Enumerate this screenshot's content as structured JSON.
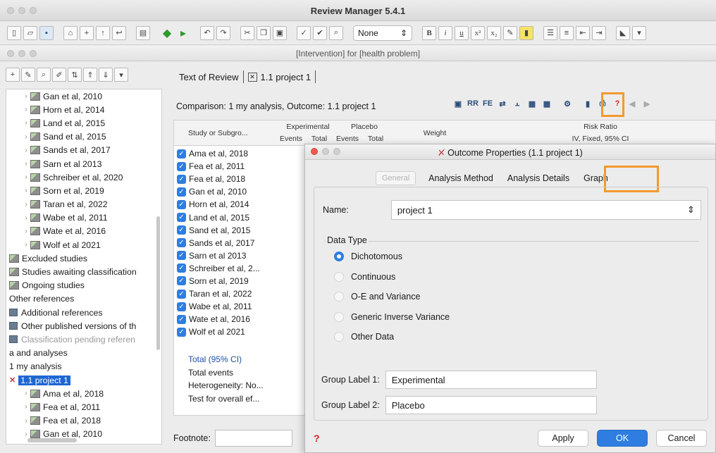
{
  "app": {
    "title": "Review Manager 5.4.1"
  },
  "toolbar": {
    "style_select": "None"
  },
  "document": {
    "title": "[Intervention] for [health problem]"
  },
  "tabs": [
    {
      "label": "Text of Review"
    },
    {
      "label": "1.1 project 1"
    }
  ],
  "comparison": {
    "label": "Comparison: 1 my analysis, Outcome: 1.1 project 1"
  },
  "right_toolbar": {
    "rr": "RR",
    "fe": "FE"
  },
  "grid": {
    "study_header": "Study or Subgro...",
    "experimental": "Experimental",
    "placebo": "Placebo",
    "events": "Events",
    "total": "Total",
    "weight": "Weight",
    "risk_ratio": "Risk Ratio",
    "rr_method": "IV, Fixed, 95% CI",
    "studies": [
      "Ama et al, 2018",
      "Fea et al, 2011",
      "Fea et al, 2018",
      "Gan et al, 2010",
      "Horn et al, 2014",
      "Land et al, 2015",
      "Sand et al, 2015",
      "Sands et al, 2017",
      "Sarn et al 2013",
      "Schreiber et al, 2...",
      "Sorn et al, 2019",
      "Taran et al, 2022",
      "Wabe et al, 2011",
      "Wate et al, 2016",
      "Wolf et al 2021"
    ],
    "totals": {
      "total": "Total (95% CI)",
      "events": "Total events",
      "heterogeneity": "Heterogeneity: No...",
      "overall": "Test for overall ef..."
    }
  },
  "footnote": {
    "label": "Footnote:"
  },
  "tree": {
    "items": [
      {
        "label": "Gan et al, 2010",
        "type": "study",
        "indent": 1
      },
      {
        "label": "Horn et al, 2014",
        "type": "study",
        "indent": 1
      },
      {
        "label": "Land et al, 2015",
        "type": "study",
        "indent": 1
      },
      {
        "label": "Sand et al, 2015",
        "type": "study",
        "indent": 1
      },
      {
        "label": "Sands et al, 2017",
        "type": "study",
        "indent": 1
      },
      {
        "label": "Sarn et al 2013",
        "type": "study",
        "indent": 1
      },
      {
        "label": "Schreiber et al, 2020",
        "type": "study",
        "indent": 1
      },
      {
        "label": "Sorn et al, 2019",
        "type": "study",
        "indent": 1
      },
      {
        "label": "Taran et al, 2022",
        "type": "study",
        "indent": 1
      },
      {
        "label": "Wabe et al, 2011",
        "type": "study",
        "indent": 1
      },
      {
        "label": "Wate et al, 2016",
        "type": "study",
        "indent": 1
      },
      {
        "label": "Wolf et al 2021",
        "type": "study",
        "indent": 1
      },
      {
        "label": "Excluded studies",
        "type": "folder",
        "indent": 0
      },
      {
        "label": "Studies awaiting classification",
        "type": "folder",
        "indent": 0
      },
      {
        "label": "Ongoing studies",
        "type": "folder",
        "indent": 0
      },
      {
        "label": "Other references",
        "type": "plain",
        "indent": 0
      },
      {
        "label": "Additional references",
        "type": "book",
        "indent": 0
      },
      {
        "label": "Other published versions of th",
        "type": "book",
        "indent": 0
      },
      {
        "label": "Classification pending referen",
        "type": "book-dim",
        "indent": 0
      },
      {
        "label": "a and analyses",
        "type": "plain",
        "indent": 0
      },
      {
        "label": "1 my analysis",
        "type": "plain",
        "indent": 0
      },
      {
        "label": "1.1 project 1",
        "type": "selected",
        "indent": 0
      },
      {
        "label": "Ama et al, 2018",
        "type": "study",
        "indent": 1
      },
      {
        "label": "Fea et al, 2011",
        "type": "study",
        "indent": 1
      },
      {
        "label": "Fea et al, 2018",
        "type": "study",
        "indent": 1
      },
      {
        "label": "Gan et al, 2010",
        "type": "study",
        "indent": 1
      }
    ]
  },
  "dialog": {
    "title": "Outcome Properties (1.1 project 1)",
    "tabs": {
      "general": "General",
      "analysis_method": "Analysis Method",
      "analysis_details": "Analysis Details",
      "graph": "Graph"
    },
    "name_label": "Name:",
    "name_value": "project 1",
    "data_type_legend": "Data Type",
    "data_types": [
      "Dichotomous",
      "Continuous",
      "O-E and Variance",
      "Generic Inverse Variance",
      "Other Data"
    ],
    "group1_label": "Group Label 1:",
    "group1_value": "Experimental",
    "group2_label": "Group Label 2:",
    "group2_value": "Placebo",
    "apply": "Apply",
    "ok": "OK",
    "cancel": "Cancel"
  },
  "colors": {
    "accent": "#2f7de1",
    "highlight": "#f29a2e",
    "selection": "#1e66d4"
  }
}
